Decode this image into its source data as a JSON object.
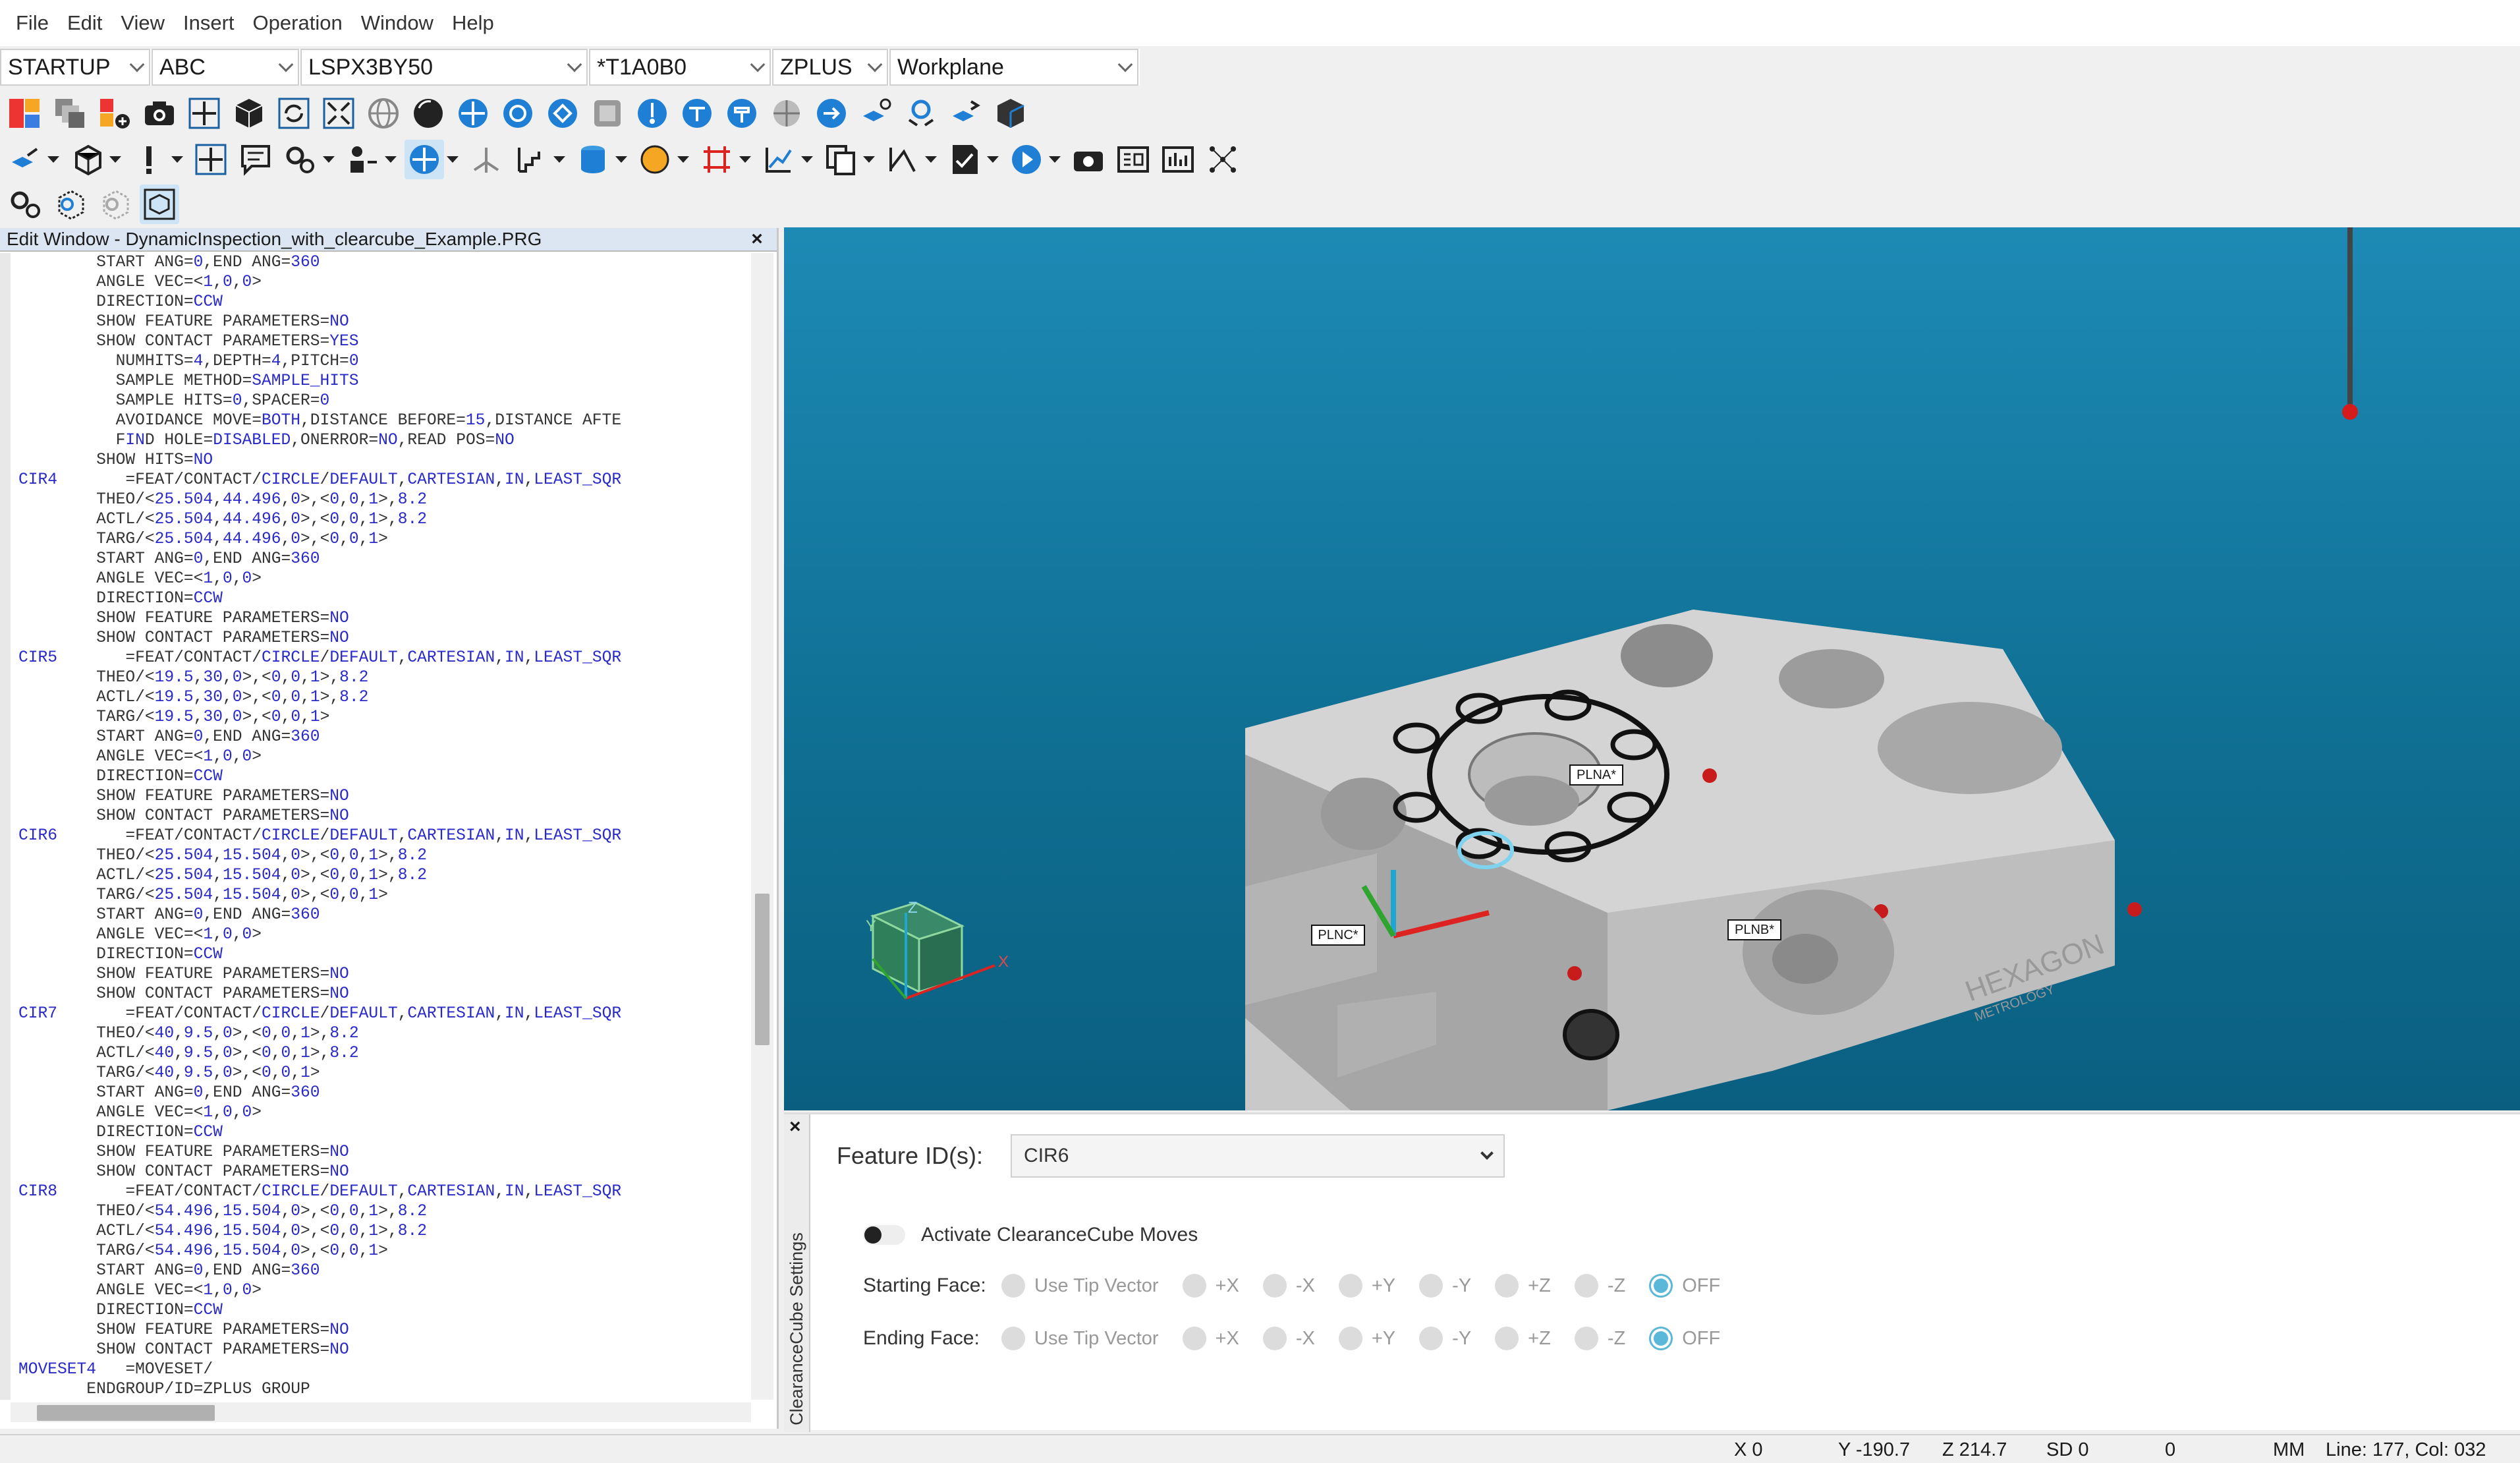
{
  "menu": [
    "File",
    "Edit",
    "View",
    "Insert",
    "Operation",
    "Window",
    "Help"
  ],
  "combos": {
    "c1": "STARTUP",
    "c2": "ABC",
    "c3": "LSPX3BY50",
    "c4": "*T1A0B0",
    "c5": "ZPLUS",
    "c6": "Workplane"
  },
  "edit_window": {
    "title": "Edit Window - DynamicInspection_with_clearcube_Example.PRG",
    "close": "×"
  },
  "code_lines": [
    [
      "",
      "        START ANG=0,END ANG=360"
    ],
    [
      "",
      "        ANGLE VEC=<1,0,0>"
    ],
    [
      "",
      "        DIRECTION=CCW"
    ],
    [
      "",
      "        SHOW FEATURE PARAMETERS=NO"
    ],
    [
      "",
      "        SHOW CONTACT PARAMETERS=YES"
    ],
    [
      "",
      "          NUMHITS=4,DEPTH=4,PITCH=0"
    ],
    [
      "",
      "          SAMPLE METHOD=SAMPLE_HITS"
    ],
    [
      "",
      "          SAMPLE HITS=0,SPACER=0"
    ],
    [
      "",
      "          AVOIDANCE MOVE=BOTH,DISTANCE BEFORE=15,DISTANCE AFTE"
    ],
    [
      "",
      "          FIND HOLE=DISABLED,ONERROR=NO,READ POS=NO"
    ],
    [
      "",
      "        SHOW HITS=NO"
    ],
    [
      "CIR4",
      "       =FEAT/CONTACT/CIRCLE/DEFAULT,CARTESIAN,IN,LEAST_SQR"
    ],
    [
      "",
      "        THEO/<25.504,44.496,0>,<0,0,1>,8.2"
    ],
    [
      "",
      "        ACTL/<25.504,44.496,0>,<0,0,1>,8.2"
    ],
    [
      "",
      "        TARG/<25.504,44.496,0>,<0,0,1>"
    ],
    [
      "",
      "        START ANG=0,END ANG=360"
    ],
    [
      "",
      "        ANGLE VEC=<1,0,0>"
    ],
    [
      "",
      "        DIRECTION=CCW"
    ],
    [
      "",
      "        SHOW FEATURE PARAMETERS=NO"
    ],
    [
      "",
      "        SHOW CONTACT PARAMETERS=NO"
    ],
    [
      "CIR5",
      "       =FEAT/CONTACT/CIRCLE/DEFAULT,CARTESIAN,IN,LEAST_SQR"
    ],
    [
      "",
      "        THEO/<19.5,30,0>,<0,0,1>,8.2"
    ],
    [
      "",
      "        ACTL/<19.5,30,0>,<0,0,1>,8.2"
    ],
    [
      "",
      "        TARG/<19.5,30,0>,<0,0,1>"
    ],
    [
      "",
      "        START ANG=0,END ANG=360"
    ],
    [
      "",
      "        ANGLE VEC=<1,0,0>"
    ],
    [
      "",
      "        DIRECTION=CCW"
    ],
    [
      "",
      "        SHOW FEATURE PARAMETERS=NO"
    ],
    [
      "",
      "        SHOW CONTACT PARAMETERS=NO"
    ],
    [
      "CIR6",
      "       =FEAT/CONTACT/CIRCLE/DEFAULT,CARTESIAN,IN,LEAST_SQR"
    ],
    [
      "",
      "        THEO/<25.504,15.504,0>,<0,0,1>,8.2"
    ],
    [
      "",
      "        ACTL/<25.504,15.504,0>,<0,0,1>,8.2"
    ],
    [
      "",
      "        TARG/<25.504,15.504,0>,<0,0,1>"
    ],
    [
      "",
      "        START ANG=0,END ANG=360"
    ],
    [
      "",
      "        ANGLE VEC=<1,0,0>"
    ],
    [
      "",
      "        DIRECTION=CCW"
    ],
    [
      "",
      "        SHOW FEATURE PARAMETERS=NO"
    ],
    [
      "",
      "        SHOW CONTACT PARAMETERS=NO"
    ],
    [
      "CIR7",
      "       =FEAT/CONTACT/CIRCLE/DEFAULT,CARTESIAN,IN,LEAST_SQR"
    ],
    [
      "",
      "        THEO/<40,9.5,0>,<0,0,1>,8.2"
    ],
    [
      "",
      "        ACTL/<40,9.5,0>,<0,0,1>,8.2"
    ],
    [
      "",
      "        TARG/<40,9.5,0>,<0,0,1>"
    ],
    [
      "",
      "        START ANG=0,END ANG=360"
    ],
    [
      "",
      "        ANGLE VEC=<1,0,0>"
    ],
    [
      "",
      "        DIRECTION=CCW"
    ],
    [
      "",
      "        SHOW FEATURE PARAMETERS=NO"
    ],
    [
      "",
      "        SHOW CONTACT PARAMETERS=NO"
    ],
    [
      "CIR8",
      "       =FEAT/CONTACT/CIRCLE/DEFAULT,CARTESIAN,IN,LEAST_SQR"
    ],
    [
      "",
      "        THEO/<54.496,15.504,0>,<0,0,1>,8.2"
    ],
    [
      "",
      "        ACTL/<54.496,15.504,0>,<0,0,1>,8.2"
    ],
    [
      "",
      "        TARG/<54.496,15.504,0>,<0,0,1>"
    ],
    [
      "",
      "        START ANG=0,END ANG=360"
    ],
    [
      "",
      "        ANGLE VEC=<1,0,0>"
    ],
    [
      "",
      "        DIRECTION=CCW"
    ],
    [
      "",
      "        SHOW FEATURE PARAMETERS=NO"
    ],
    [
      "",
      "        SHOW CONTACT PARAMETERS=NO"
    ],
    [
      "MOVESET4",
      "   =MOVESET/"
    ],
    [
      "",
      "       ENDGROUP/ID=ZPLUS GROUP"
    ]
  ],
  "viewport": {
    "labels": {
      "plna": "PLNA*",
      "plnb": "PLNB*",
      "plnc": "PLNC*"
    },
    "axes": {
      "x": "X",
      "y": "Y",
      "z": "Z"
    },
    "brand": "HEXAGON",
    "brand_sub": "METROLOGY"
  },
  "clearance": {
    "tab_label": "ClearanceCube Settings",
    "close": "×",
    "feature_label": "Feature ID(s):",
    "feature_value": "CIR6",
    "activate_label": "Activate ClearanceCube Moves",
    "starting_label": "Starting Face:",
    "ending_label": "Ending Face:",
    "options": [
      "Use Tip Vector",
      "+X",
      "-X",
      "+Y",
      "-Y",
      "+Z",
      "-Z",
      "OFF"
    ],
    "selected": "OFF"
  },
  "status": {
    "x": "X 0",
    "y": "Y -190.7",
    "z": "Z 214.7",
    "sd": "SD 0",
    "zero": "0",
    "units": "MM",
    "line": "Line: 177, Col: 032"
  },
  "colors": {
    "viewport_top": "#1d8ab5",
    "viewport_bottom": "#0a5f80",
    "accent": "#5bb8d8",
    "code_blue": "#2a2ac8"
  }
}
